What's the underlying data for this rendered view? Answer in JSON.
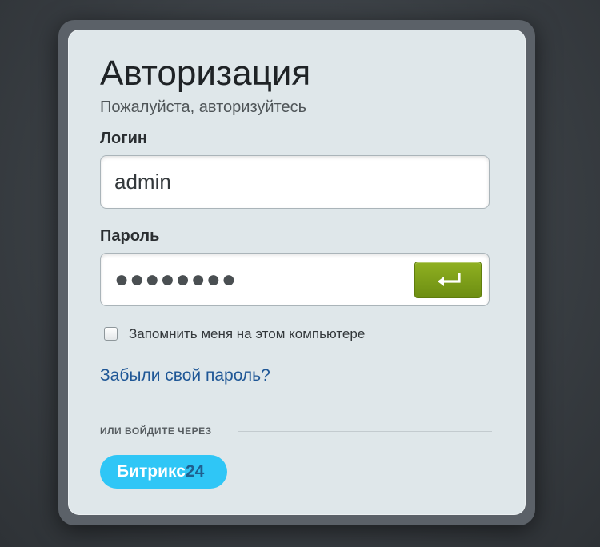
{
  "login_form": {
    "title": "Авторизация",
    "subtitle": "Пожалуйста, авторизуйтесь",
    "login_label": "Логин",
    "login_value": "admin",
    "password_label": "Пароль",
    "password_masked": "●●●●●●●●",
    "submit_icon": "enter-return-icon",
    "remember_label": "Запомнить меня на этом компьютере",
    "remember_checked": false,
    "forgot_link": "Забыли свой пароль?",
    "or_login_with": "ИЛИ ВОЙДИТЕ ЧЕРЕЗ",
    "provider": {
      "name_word": "Битрикс",
      "name_number": "24",
      "color": "#2fc6f6"
    }
  },
  "colors": {
    "accent_green": "#7a9c18",
    "link": "#1f5796",
    "card_bg": "#dfe7ea"
  }
}
